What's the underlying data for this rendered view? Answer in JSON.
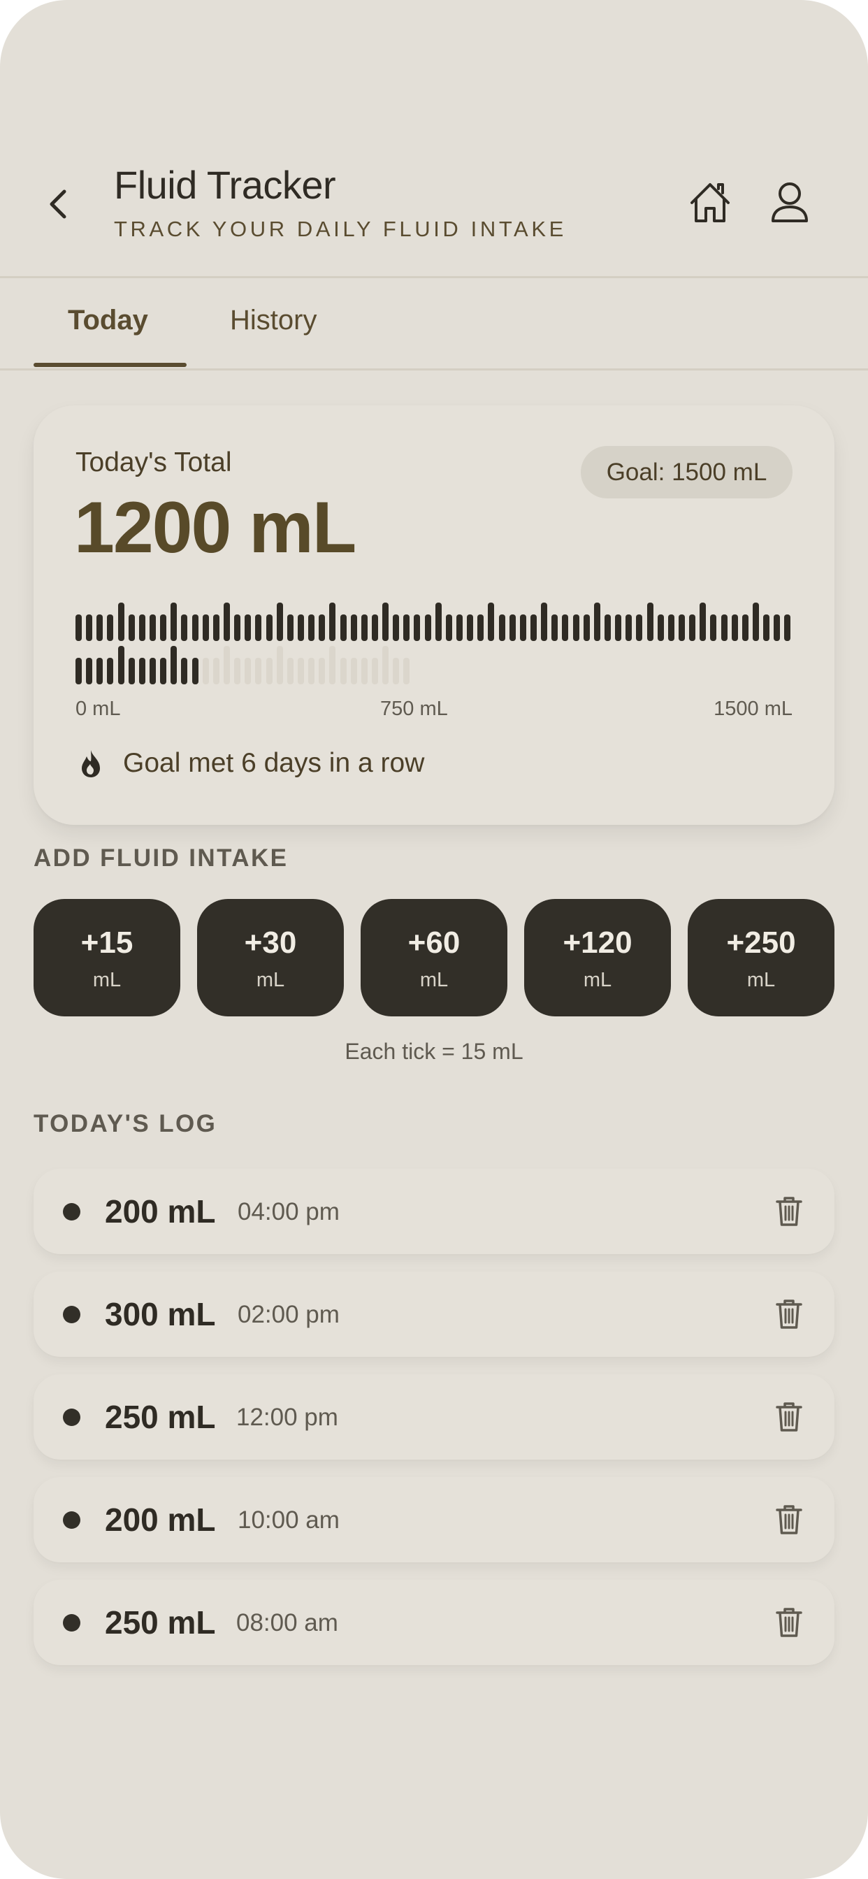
{
  "header": {
    "title": "Fluid Tracker",
    "subtitle": "TRACK YOUR DAILY FLUID INTAKE",
    "icons": {
      "back": "chevron-left-icon",
      "home": "home-icon",
      "profile": "user-icon"
    }
  },
  "tabs": [
    {
      "label": "Today",
      "active": true
    },
    {
      "label": "History",
      "active": false
    }
  ],
  "summary": {
    "total_label": "Today's Total",
    "total_value": "1200 mL",
    "goal_label": "Goal: 1500 mL",
    "progress": {
      "current_ml": 1200,
      "goal_ml": 1500,
      "tick_ml": 15
    },
    "scale": {
      "start": "0 mL",
      "mid": "750 mL",
      "end": "1500 mL"
    },
    "streak_text": "Goal met 6 days in a row",
    "streak_icon": "flame-icon"
  },
  "add_section": {
    "label": "ADD FLUID INTAKE",
    "buttons": [
      {
        "amount": "+15",
        "unit": "mL"
      },
      {
        "amount": "+30",
        "unit": "mL"
      },
      {
        "amount": "+60",
        "unit": "mL"
      },
      {
        "amount": "+120",
        "unit": "mL"
      },
      {
        "amount": "+250",
        "unit": "mL"
      }
    ],
    "note": "Each tick = 15 mL"
  },
  "log": {
    "label": "TODAY'S LOG",
    "entries": [
      {
        "amount": "200 mL",
        "time": "04:00 pm"
      },
      {
        "amount": "300 mL",
        "time": "02:00 pm"
      },
      {
        "amount": "250 mL",
        "time": "12:00 pm"
      },
      {
        "amount": "200 mL",
        "time": "10:00 am"
      },
      {
        "amount": "250 mL",
        "time": "08:00 am"
      }
    ],
    "delete_icon": "trash-icon"
  },
  "colors": {
    "background": "#e3dfd7",
    "card": "#e5e1d9",
    "accent": "#584a29",
    "button": "#322f28",
    "tick_filled": "#2f2b24",
    "tick_empty": "#dbd6cc"
  }
}
